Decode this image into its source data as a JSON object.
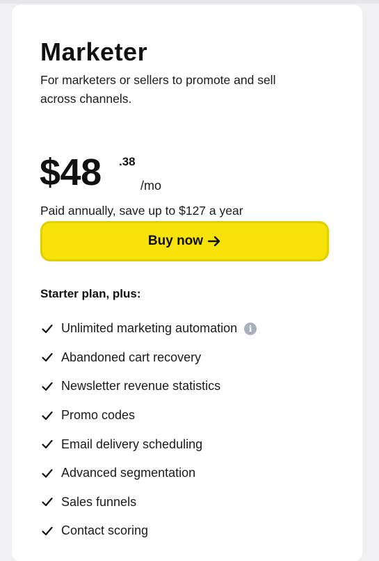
{
  "plan": {
    "title": "Marketer",
    "description": "For marketers or sellers to promote and sell across channels."
  },
  "price": {
    "dollars": "$48",
    "cents": ".38",
    "period": "/mo",
    "billing_note": "Paid annually, save up to $127 a year"
  },
  "cta": {
    "label": "Buy now",
    "icon": "arrow-right-icon",
    "color": "#f7e20a"
  },
  "features": {
    "heading": "Starter plan, plus:",
    "items": [
      {
        "label": "Unlimited marketing automation",
        "info_icon": "info-icon"
      },
      {
        "label": "Abandoned cart recovery"
      },
      {
        "label": "Newsletter revenue statistics"
      },
      {
        "label": "Promo codes"
      },
      {
        "label": "Email delivery scheduling"
      },
      {
        "label": "Advanced segmentation"
      },
      {
        "label": "Sales funnels"
      },
      {
        "label": "Contact scoring"
      }
    ]
  }
}
